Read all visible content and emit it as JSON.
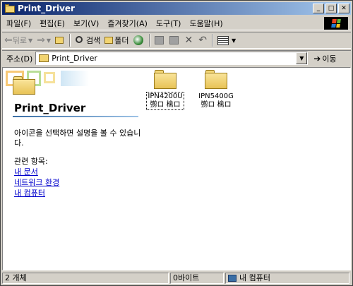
{
  "window": {
    "title": "Print_Driver"
  },
  "menu": [
    "파일(F)",
    "편집(E)",
    "보기(V)",
    "즐겨찾기(A)",
    "도구(T)",
    "도움말(H)"
  ],
  "toolbar": {
    "back": "뒤로",
    "search": "검색",
    "folders": "폴더",
    "delete": "✕",
    "undo": "↶"
  },
  "address": {
    "label": "주소(D)",
    "value": "Print_Driver",
    "go": "이동"
  },
  "panel": {
    "title": "Print_Driver",
    "description": "아이콘을 선택하면 설명을 볼 수 있습니다.",
    "related_label": "관련 항목:",
    "links": [
      "내 문서",
      "네트워크 환경",
      "내 컴퓨터"
    ]
  },
  "files": [
    {
      "name": "IPN4200U",
      "sub": "彅ロ 檎ロ",
      "icon": "folder-icon",
      "selected": true
    },
    {
      "name": "IPN5400G",
      "sub": "彅ロ 檎ロ",
      "icon": "folder-icon",
      "selected": false
    }
  ],
  "status": {
    "count": "2 개체",
    "size": "0바이트",
    "zone": "내 컴퓨터"
  }
}
